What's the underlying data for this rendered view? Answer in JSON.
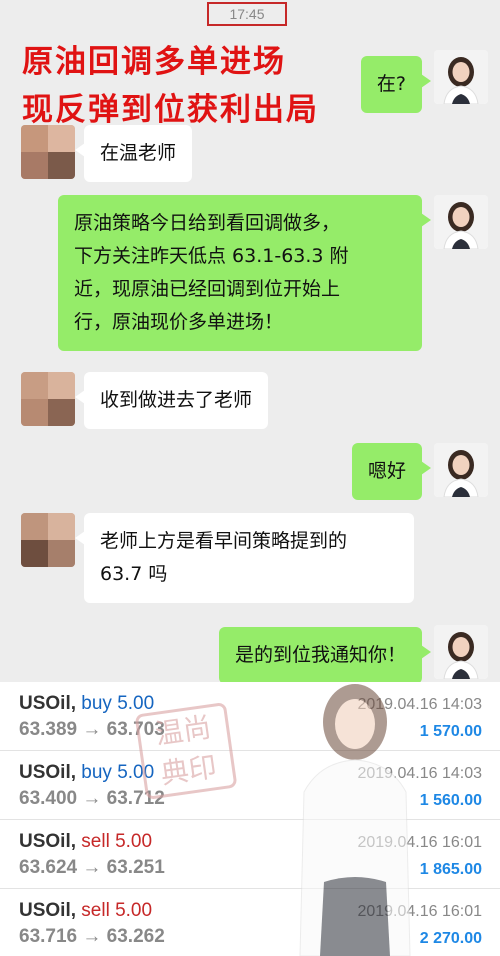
{
  "status": {
    "time": "17:45"
  },
  "headline": {
    "line1": "原油回调多单进场",
    "line2": "现反弹到位获利出局"
  },
  "messages": [
    {
      "from": "teacher",
      "text": "在?"
    },
    {
      "from": "user",
      "text": "在温老师"
    },
    {
      "from": "teacher",
      "lines": [
        "原油策略今日给到看回调做多，",
        "下方关注昨天低点 63.1-63.3 附",
        "近，现原油已经回调到位开始上",
        "行，原油现价多单进场！"
      ]
    },
    {
      "from": "user",
      "text": "收到做进去了老师"
    },
    {
      "from": "teacher",
      "text": "嗯好"
    },
    {
      "from": "user",
      "lines": [
        "老师上方是看早间策略提到的",
        "63.7 吗"
      ]
    },
    {
      "from": "teacher",
      "text": "是的到位我通知你！"
    }
  ],
  "trades": [
    {
      "symbol": "USOil,",
      "side": "buy 5.00",
      "side_type": "buy",
      "prices": "63.389 → 63.703",
      "date": "2019.04.16 14:03",
      "profit": "1 570.00"
    },
    {
      "symbol": "USOil,",
      "side": "buy 5.00",
      "side_type": "buy",
      "prices": "63.400 → 63.712",
      "date": "2019.04.16 14:03",
      "profit": "1 560.00"
    },
    {
      "symbol": "USOil,",
      "side": "sell 5.00",
      "side_type": "sell",
      "prices": "63.624 → 63.251",
      "date": "2019.04.16 16:01",
      "profit": "1 865.00"
    },
    {
      "symbol": "USOil,",
      "side": "sell 5.00",
      "side_type": "sell",
      "prices": "63.716 → 63.262",
      "date": "2019.04.16 16:01",
      "profit": "2 270.00"
    }
  ],
  "watermark": {
    "text": "温尚\n典印"
  },
  "colors": {
    "headline": "#e01313",
    "bubble_green": "#95ec69",
    "buy": "#1565c0",
    "sell": "#c62828",
    "profit": "#1e88e5"
  }
}
